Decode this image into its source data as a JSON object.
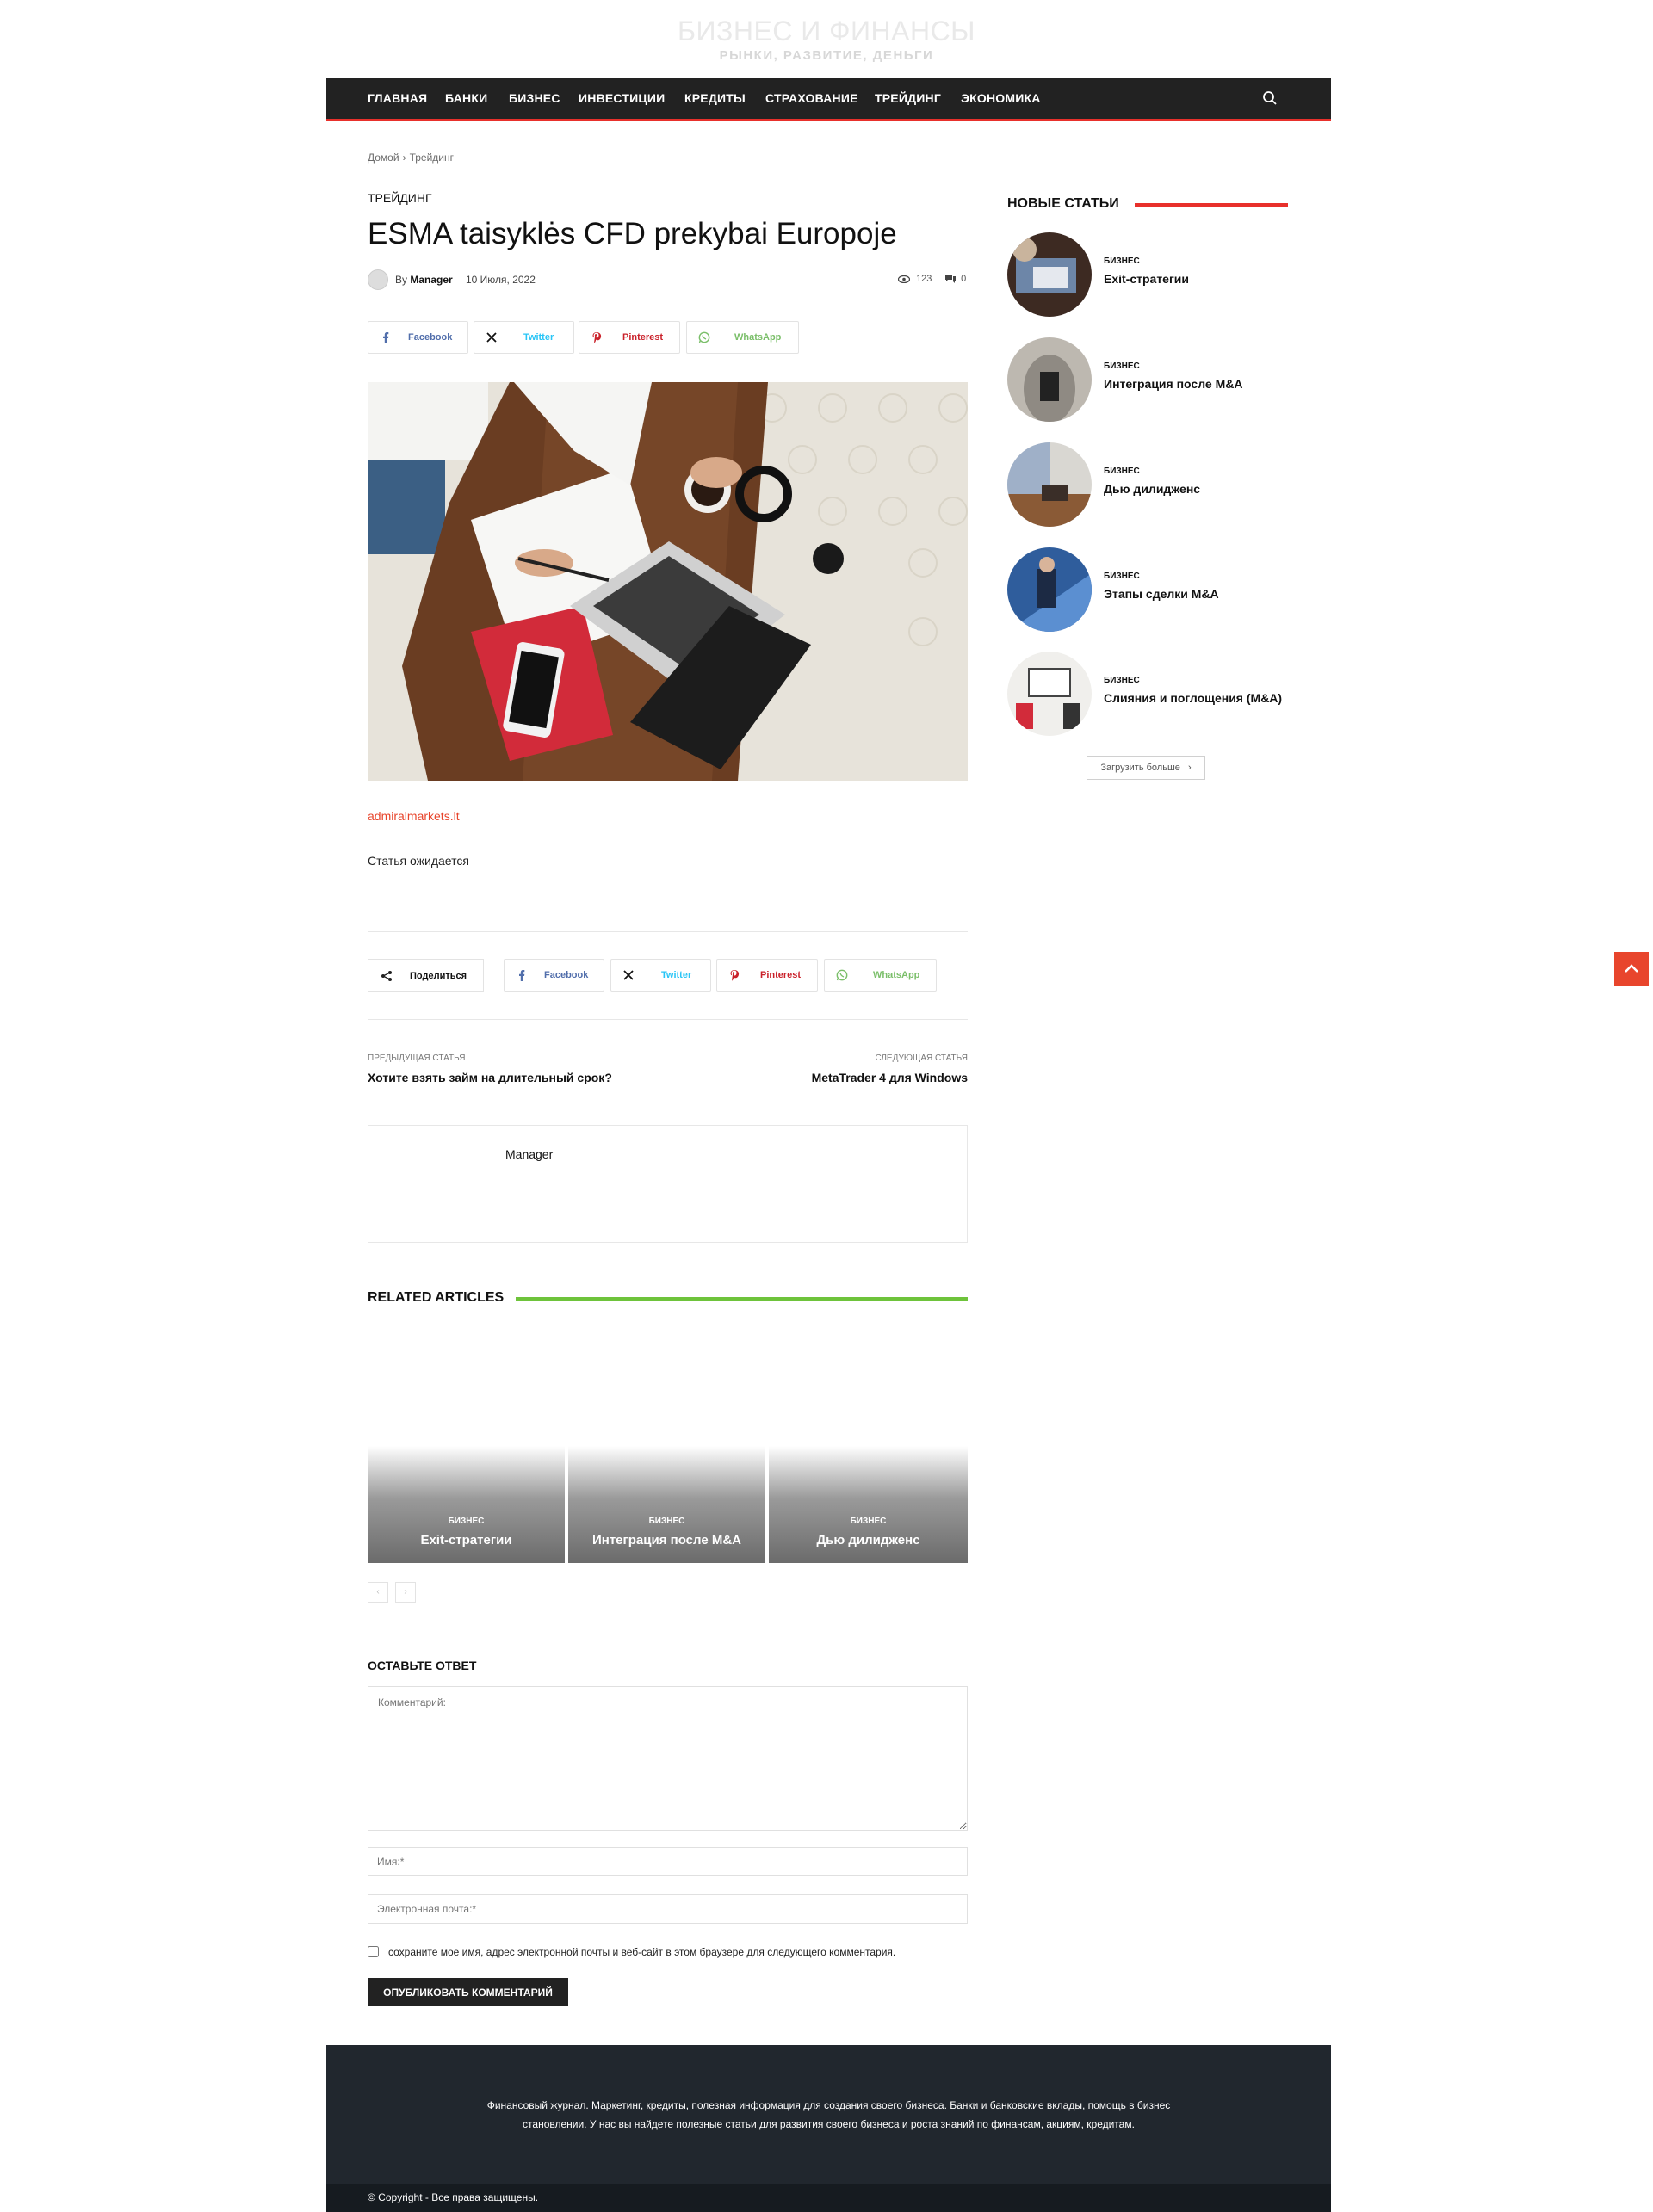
{
  "site": {
    "title": "БИЗНЕС И ФИНАНСЫ",
    "tagline": "РЫНКИ, РАЗВИТИЕ, ДЕНЬГИ"
  },
  "nav": {
    "items": [
      "ГЛАВНАЯ",
      "БАНКИ",
      "БИЗНЕС",
      "ИНВЕСТИЦИИ",
      "КРЕДИТЫ",
      "СТРАХОВАНИЕ",
      "ТРЕЙДИНГ",
      "ЭКОНОМИКА"
    ]
  },
  "breadcrumb": [
    "Домой",
    "›",
    "Трейдинг"
  ],
  "article": {
    "category": "ТРЕЙДИНГ",
    "title": "ESMA taisyklės CFD prekybai Europoje",
    "by": "By",
    "author": "Manager",
    "date": "10 Июля, 2022",
    "views": "123",
    "comments": "0",
    "source_link": "admiralmarkets.lt",
    "body": "Статья ожидается"
  },
  "share": {
    "label": "Поделиться",
    "facebook": "Facebook",
    "twitter": "Twitter",
    "pinterest": "Pinterest",
    "whatsapp": "WhatsApp"
  },
  "post_nav": {
    "prev_label": "ПРЕДЫДУЩАЯ СТАТЬЯ",
    "prev_title": "Хотите взять займ на длительный срок?",
    "next_label": "СЛЕДУЮЩАЯ СТАТЬЯ",
    "next_title": "MetaTrader 4 для Windows"
  },
  "author_box": {
    "name": "Manager"
  },
  "related": {
    "title": "RELATED ARTICLES",
    "items": [
      {
        "category": "БИЗНЕС",
        "title": "Exit-стратегии"
      },
      {
        "category": "БИЗНЕС",
        "title": "Интеграция после M&A"
      },
      {
        "category": "БИЗНЕС",
        "title": "Дью дилидженс"
      }
    ],
    "prev": "‹",
    "next": "›"
  },
  "reply": {
    "title": "ОСТАВЬТЕ ОТВЕТ",
    "comment_placeholder": "Комментарий:",
    "name_placeholder": "Имя:*",
    "email_placeholder": "Электронная почта:*",
    "save_text": "сохраните мое имя, адрес электронной почты и веб-сайт в этом браузере для следующего комментария.",
    "submit": "ОПУБЛИКОВАТЬ КОММЕНТАРИЙ"
  },
  "sidebar": {
    "title": "НОВЫЕ СТАТЬИ",
    "items": [
      {
        "category": "БИЗНЕС",
        "title": "Exit-стратегии"
      },
      {
        "category": "БИЗНЕС",
        "title": "Интеграция после M&A"
      },
      {
        "category": "БИЗНЕС",
        "title": "Дью дилидженс"
      },
      {
        "category": "БИЗНЕС",
        "title": "Этапы сделки M&A"
      },
      {
        "category": "БИЗНЕС",
        "title": "Слияния и поглощения (M&A)"
      }
    ],
    "load_more": "Загрузить больше"
  },
  "footer": {
    "line1": "Финансовый журнал. Маркетинг, кредиты, полезная информация для создания своего бизнеса. Банки и банковские вклады, помощь в бизнес",
    "line2": "становлении. У нас вы найдете полезные статьи для развития своего бизнеса и роста знаний по финансам, акциям, кредитам.",
    "copyright": "© Copyright - Все права защищены."
  },
  "colors": {
    "accent": "#e8302b",
    "related_accent": "#6ec33b",
    "nav_bg": "#222222",
    "footer_bg": "#21272e",
    "facebook": "#516eab",
    "twitter": "#29c5f6",
    "pinterest": "#ca212a",
    "whatsapp": "#7bbf6a"
  }
}
